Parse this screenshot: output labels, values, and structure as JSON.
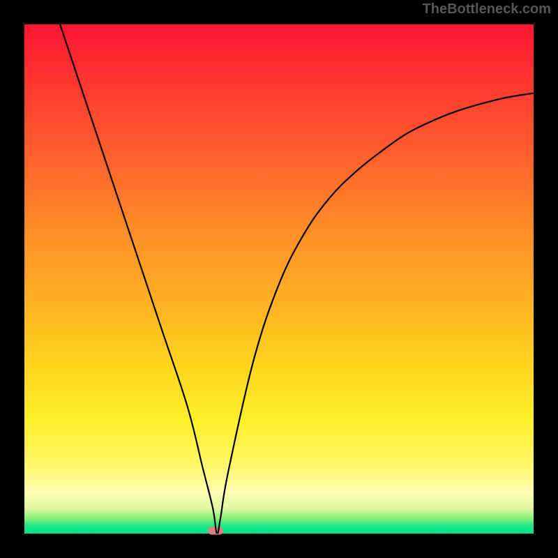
{
  "watermark": "TheBottleneck.com",
  "chart_data": {
    "type": "line",
    "title": "",
    "xlabel": "",
    "ylabel": "",
    "xlim": [
      0,
      100
    ],
    "ylim": [
      0,
      100
    ],
    "series": [
      {
        "name": "bottleneck-curve",
        "x": [
          7,
          12,
          17,
          22,
          27,
          32,
          35,
          37,
          37.8,
          38.5,
          40,
          45,
          50,
          55,
          60,
          65,
          70,
          75,
          80,
          85,
          90,
          95,
          100
        ],
        "values": [
          100,
          85,
          70,
          55,
          40,
          25,
          13,
          5,
          0,
          3,
          12,
          34,
          49,
          59,
          66,
          71,
          75,
          78.5,
          81,
          83,
          84.5,
          85.7,
          86.5
        ]
      }
    ],
    "marker": {
      "x": 37.5,
      "y": 0.5,
      "label": "optimal-point"
    },
    "gradient_stops": [
      {
        "pct": 0,
        "color": "#ff1432"
      },
      {
        "pct": 40,
        "color": "#ff8c28"
      },
      {
        "pct": 70,
        "color": "#ffe21e"
      },
      {
        "pct": 92,
        "color": "#fffbb4"
      },
      {
        "pct": 100,
        "color": "#00e08d"
      }
    ]
  }
}
